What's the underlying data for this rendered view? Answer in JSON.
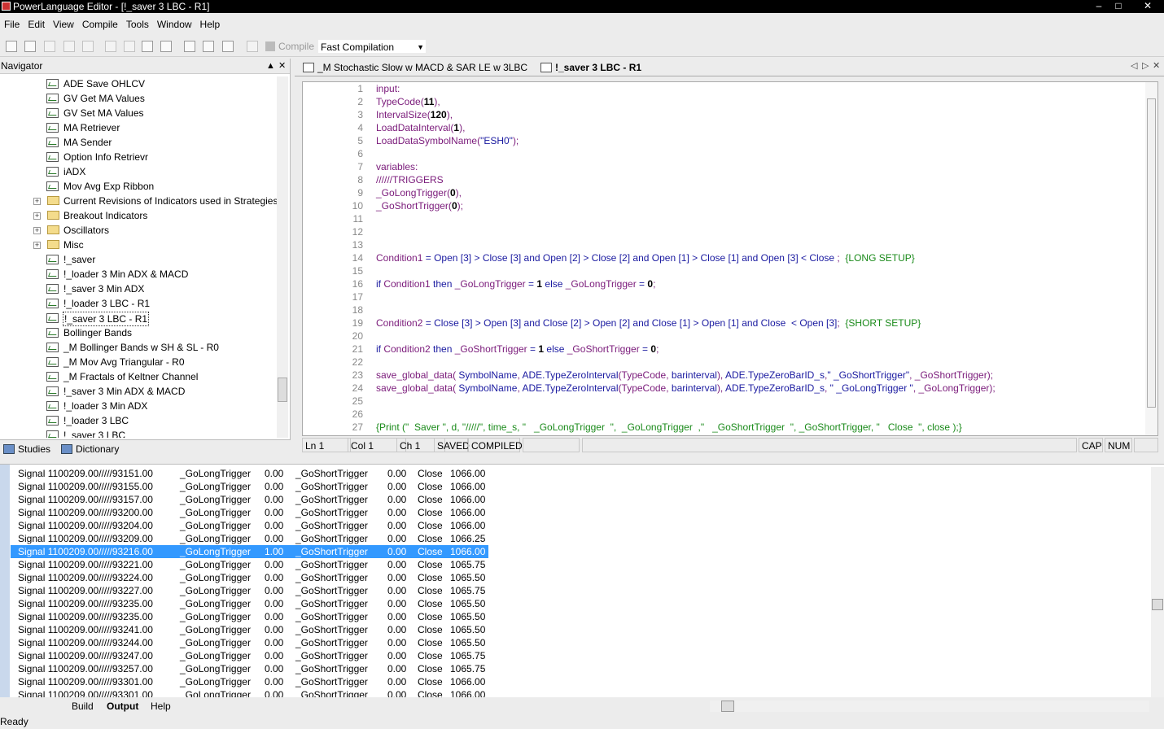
{
  "window": {
    "title": "PowerLanguage Editor - [!_saver 3 LBC - R1]",
    "min": "–",
    "max": "□",
    "close": "✕"
  },
  "menu": [
    "File",
    "Edit",
    "View",
    "Compile",
    "Tools",
    "Window",
    "Help"
  ],
  "toolbar": {
    "compile_label": "Compile",
    "compile_mode": "Fast Compilation",
    "icons": [
      "new-icon",
      "open-icon",
      "save-icon",
      "save-all-icon",
      "export-icon",
      "undo-icon",
      "redo-icon",
      "find-icon",
      "find-next-icon",
      "layout-icon",
      "split-h-icon",
      "split-v-icon",
      "properties-icon"
    ]
  },
  "navigator": {
    "title": "Navigator",
    "pin": "▲",
    "close": "✕",
    "items": [
      {
        "label": "ADE Save OHLCV",
        "type": "study"
      },
      {
        "label": "GV Get MA Values",
        "type": "study"
      },
      {
        "label": "GV Set MA Values",
        "type": "study"
      },
      {
        "label": "MA Retriever",
        "type": "study"
      },
      {
        "label": "MA Sender",
        "type": "study"
      },
      {
        "label": "Option Info Retrievr",
        "type": "study"
      },
      {
        "label": "iADX",
        "type": "study"
      },
      {
        "label": "Mov Avg Exp Ribbon",
        "type": "study"
      },
      {
        "label": "Current Revisions of Indicators used in Strategies",
        "type": "folder"
      },
      {
        "label": "Breakout Indicators",
        "type": "folder"
      },
      {
        "label": "Oscillators",
        "type": "folder"
      },
      {
        "label": "Misc",
        "type": "folder"
      },
      {
        "label": "!_saver",
        "type": "study"
      },
      {
        "label": "!_loader 3 Min ADX & MACD",
        "type": "study"
      },
      {
        "label": "!_saver 3 Min ADX",
        "type": "study"
      },
      {
        "label": "!_loader 3 LBC - R1",
        "type": "study"
      },
      {
        "label": "!_saver 3 LBC - R1",
        "type": "study",
        "selected": true
      },
      {
        "label": "Bollinger Bands",
        "type": "study"
      },
      {
        "label": "_M Bollinger Bands w SH & SL - R0",
        "type": "study"
      },
      {
        "label": "_M Mov Avg Triangular - R0",
        "type": "study"
      },
      {
        "label": "_M Fractals of Keltner Channel",
        "type": "study"
      },
      {
        "label": "!_saver 3 Min ADX & MACD",
        "type": "study"
      },
      {
        "label": "!_loader 3 Min ADX",
        "type": "study"
      },
      {
        "label": "!_loader 3 LBC",
        "type": "study"
      },
      {
        "label": "!_saver 3 LBC",
        "type": "study"
      }
    ],
    "tabs": [
      "Studies",
      "Dictionary"
    ]
  },
  "doc_tabs": [
    {
      "label": "_M Stochastic Slow w MACD & SAR LE w 3LBC",
      "active": false
    },
    {
      "label": "!_saver 3 LBC - R1",
      "active": true
    }
  ],
  "doc_nav": {
    "prev": "◁",
    "next": "▷",
    "close": "✕"
  },
  "code_lines": [
    {
      "n": "1",
      "html": "input:"
    },
    {
      "n": "2",
      "html": "TypeCode(<span class=\"n\">11</span>),"
    },
    {
      "n": "3",
      "html": "IntervalSize(<span class=\"n\">120</span>),"
    },
    {
      "n": "4",
      "html": "LoadDataInterval(<span class=\"n\">1</span>),"
    },
    {
      "n": "5",
      "html": "LoadDataSymbolName(<span class=\"s\">\"ESH0\"</span>);"
    },
    {
      "n": "6",
      "html": ""
    },
    {
      "n": "7",
      "html": "variables:"
    },
    {
      "n": "8",
      "html": "//////TRIGGERS"
    },
    {
      "n": "9",
      "html": "_GoLongTrigger(<span class=\"n\">0</span>),"
    },
    {
      "n": "10",
      "html": "_GoShortTrigger(<span class=\"n\">0</span>);"
    },
    {
      "n": "11",
      "html": ""
    },
    {
      "n": "12",
      "html": ""
    },
    {
      "n": "13",
      "html": ""
    },
    {
      "n": "14",
      "html": "Condition1 <span class=\"b\">=</span> <span class=\"b\">Open</span> <span class=\"b\">[3]</span> <span class=\"b\">&gt;</span> <span class=\"b\">Close</span> <span class=\"b\">[3]</span> <span class=\"b\">and</span> <span class=\"b\">Open</span> <span class=\"b\">[2]</span> <span class=\"b\">&gt;</span> <span class=\"b\">Close</span> <span class=\"b\">[2]</span> <span class=\"b\">and</span> <span class=\"b\">Open</span> <span class=\"b\">[1]</span> <span class=\"b\">&gt;</span> <span class=\"b\">Close</span> <span class=\"b\">[1]</span> <span class=\"b\">and</span> <span class=\"b\">Open</span> <span class=\"b\">[3]</span> <span class=\"b\">&lt;</span> <span class=\"b\">Close</span> ;  <span class=\"c\">{LONG SETUP}</span>"
    },
    {
      "n": "15",
      "html": ""
    },
    {
      "n": "16",
      "html": "<span class=\"b\">if</span> Condition1 <span class=\"b\">then</span> _GoLongTrigger <span class=\"b\">=</span> <span class=\"n\">1</span> <span class=\"b\">else</span> _GoLongTrigger <span class=\"b\">=</span> <span class=\"n\">0</span>;"
    },
    {
      "n": "17",
      "html": ""
    },
    {
      "n": "18",
      "html": ""
    },
    {
      "n": "19",
      "html": "Condition2 <span class=\"b\">=</span> <span class=\"b\">Close</span> <span class=\"b\">[3]</span> <span class=\"b\">&gt;</span> <span class=\"b\">Open</span> <span class=\"b\">[3]</span> <span class=\"b\">and</span> <span class=\"b\">Close</span> <span class=\"b\">[2]</span> <span class=\"b\">&gt;</span> <span class=\"b\">Open</span> <span class=\"b\">[2]</span> <span class=\"b\">and</span> <span class=\"b\">Close</span> <span class=\"b\">[1]</span> <span class=\"b\">&gt;</span> <span class=\"b\">Open</span> <span class=\"b\">[1]</span> <span class=\"b\">and</span> <span class=\"b\">Close</span>  <span class=\"b\">&lt;</span> <span class=\"b\">Open</span> <span class=\"b\">[3]</span>;  <span class=\"c\">{SHORT SETUP}</span>"
    },
    {
      "n": "20",
      "html": ""
    },
    {
      "n": "21",
      "html": "<span class=\"b\">if</span> Condition2 <span class=\"b\">then</span> _GoShortTrigger <span class=\"b\">=</span> <span class=\"n\">1</span> <span class=\"b\">else</span> _GoShortTrigger <span class=\"b\">=</span> <span class=\"n\">0</span>;"
    },
    {
      "n": "22",
      "html": ""
    },
    {
      "n": "23",
      "html": "save_global_data( <span class=\"b\">SymbolName</span>, <span class=\"b\">ADE.TypeZeroInterval</span>(TypeCode, <span class=\"b\">barinterval</span>), <span class=\"b\">ADE.TypeZeroBarID_s</span>,<span class=\"s\">\" _GoShortTrigger\"</span>, _GoShortTrigger);"
    },
    {
      "n": "24",
      "html": "save_global_data( <span class=\"b\">SymbolName</span>, <span class=\"b\">ADE.TypeZeroInterval</span>(TypeCode, <span class=\"b\">barinterval</span>), <span class=\"b\">ADE.TypeZeroBarID_s</span>, <span class=\"s\">\" _GoLongTrigger \"</span>, _GoLongTrigger);"
    },
    {
      "n": "25",
      "html": ""
    },
    {
      "n": "26",
      "html": ""
    },
    {
      "n": "27",
      "html": "<span class=\"c\">{Print (\"  Saver \", d, \"/////\", time_s, \"   _GoLongTrigger  \",  _GoLongTrigger  ,\"   _GoShortTrigger  \", _GoShortTrigger, \"   Close  \", close );}</span>"
    }
  ],
  "editor_status": {
    "ln": "Ln 1",
    "col": "Col 1",
    "ch": "Ch 1",
    "saved": "SAVED",
    "compiled": "COMPILED",
    "cap": "CAP",
    "num": "NUM"
  },
  "output_rows": [
    {
      "sig": "Signal 1100209.00/////93151.00",
      "l": "_GoLongTrigger",
      "lv": "0.00",
      "s": "_GoShortTrigger",
      "sv": "0.00",
      "c": "Close",
      "cv": "1066.00"
    },
    {
      "sig": "Signal 1100209.00/////93155.00",
      "l": "_GoLongTrigger",
      "lv": "0.00",
      "s": "_GoShortTrigger",
      "sv": "0.00",
      "c": "Close",
      "cv": "1066.00"
    },
    {
      "sig": "Signal 1100209.00/////93157.00",
      "l": "_GoLongTrigger",
      "lv": "0.00",
      "s": "_GoShortTrigger",
      "sv": "0.00",
      "c": "Close",
      "cv": "1066.00"
    },
    {
      "sig": "Signal 1100209.00/////93200.00",
      "l": "_GoLongTrigger",
      "lv": "0.00",
      "s": "_GoShortTrigger",
      "sv": "0.00",
      "c": "Close",
      "cv": "1066.00"
    },
    {
      "sig": "Signal 1100209.00/////93204.00",
      "l": "_GoLongTrigger",
      "lv": "0.00",
      "s": "_GoShortTrigger",
      "sv": "0.00",
      "c": "Close",
      "cv": "1066.00"
    },
    {
      "sig": "Signal 1100209.00/////93209.00",
      "l": "_GoLongTrigger",
      "lv": "0.00",
      "s": "_GoShortTrigger",
      "sv": "0.00",
      "c": "Close",
      "cv": "1066.25"
    },
    {
      "sig": "Signal 1100209.00/////93216.00",
      "l": "_GoLongTrigger",
      "lv": "1.00",
      "s": "_GoShortTrigger",
      "sv": "0.00",
      "c": "Close",
      "cv": "1066.00",
      "selected": true
    },
    {
      "sig": "Signal 1100209.00/////93221.00",
      "l": "_GoLongTrigger",
      "lv": "0.00",
      "s": "_GoShortTrigger",
      "sv": "0.00",
      "c": "Close",
      "cv": "1065.75"
    },
    {
      "sig": "Signal 1100209.00/////93224.00",
      "l": "_GoLongTrigger",
      "lv": "0.00",
      "s": "_GoShortTrigger",
      "sv": "0.00",
      "c": "Close",
      "cv": "1065.50"
    },
    {
      "sig": "Signal 1100209.00/////93227.00",
      "l": "_GoLongTrigger",
      "lv": "0.00",
      "s": "_GoShortTrigger",
      "sv": "0.00",
      "c": "Close",
      "cv": "1065.75"
    },
    {
      "sig": "Signal 1100209.00/////93235.00",
      "l": "_GoLongTrigger",
      "lv": "0.00",
      "s": "_GoShortTrigger",
      "sv": "0.00",
      "c": "Close",
      "cv": "1065.50"
    },
    {
      "sig": "Signal 1100209.00/////93235.00",
      "l": "_GoLongTrigger",
      "lv": "0.00",
      "s": "_GoShortTrigger",
      "sv": "0.00",
      "c": "Close",
      "cv": "1065.50"
    },
    {
      "sig": "Signal 1100209.00/////93241.00",
      "l": "_GoLongTrigger",
      "lv": "0.00",
      "s": "_GoShortTrigger",
      "sv": "0.00",
      "c": "Close",
      "cv": "1065.50"
    },
    {
      "sig": "Signal 1100209.00/////93244.00",
      "l": "_GoLongTrigger",
      "lv": "0.00",
      "s": "_GoShortTrigger",
      "sv": "0.00",
      "c": "Close",
      "cv": "1065.50"
    },
    {
      "sig": "Signal 1100209.00/////93247.00",
      "l": "_GoLongTrigger",
      "lv": "0.00",
      "s": "_GoShortTrigger",
      "sv": "0.00",
      "c": "Close",
      "cv": "1065.75"
    },
    {
      "sig": "Signal 1100209.00/////93257.00",
      "l": "_GoLongTrigger",
      "lv": "0.00",
      "s": "_GoShortTrigger",
      "sv": "0.00",
      "c": "Close",
      "cv": "1065.75"
    },
    {
      "sig": "Signal 1100209.00/////93301.00",
      "l": "_GoLongTrigger",
      "lv": "0.00",
      "s": "_GoShortTrigger",
      "sv": "0.00",
      "c": "Close",
      "cv": "1066.00"
    },
    {
      "sig": "Signal 1100209.00/////93301.00",
      "l": "_GoLongTrigger",
      "lv": "0.00",
      "s": "_GoShortTrigger",
      "sv": "0.00",
      "c": "Close",
      "cv": "1066.00"
    }
  ],
  "output_tabs": [
    "Build",
    "Output",
    "Help"
  ],
  "output_tab_active": "Output",
  "app_status": "Ready"
}
